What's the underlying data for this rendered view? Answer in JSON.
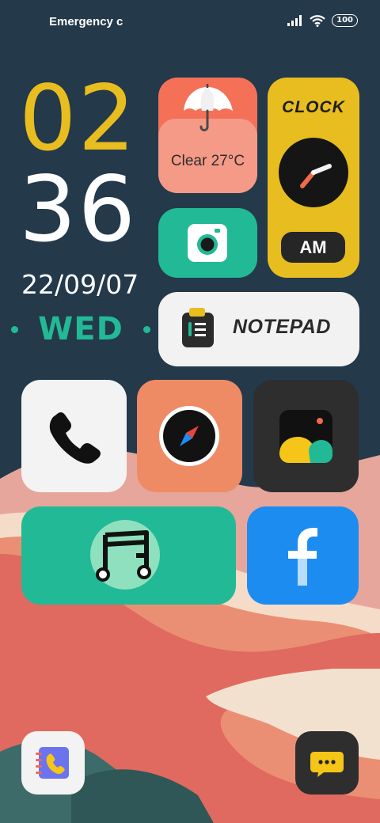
{
  "status_bar": {
    "carrier": "Emergency c",
    "battery": "100"
  },
  "clock": {
    "hour": "02",
    "minute": "36",
    "date": "22/09/07",
    "day": "WED"
  },
  "widgets": {
    "weather": {
      "text": "Clear 27°C",
      "icon": "umbrella-icon"
    },
    "camera": {
      "icon": "camera-icon"
    },
    "clock_widget": {
      "title": "CLOCK",
      "period": "AM"
    },
    "notepad": {
      "label": "NOTEPAD",
      "icon": "clipboard-icon"
    }
  },
  "apps": [
    {
      "name": "phone",
      "icon": "phone-icon"
    },
    {
      "name": "compass",
      "icon": "compass-icon"
    },
    {
      "name": "gallery",
      "icon": "gallery-icon"
    },
    {
      "name": "music",
      "icon": "music-note-icon"
    },
    {
      "name": "facebook",
      "icon": "facebook-icon"
    }
  ],
  "dock": [
    {
      "name": "contacts",
      "icon": "contacts-icon"
    },
    {
      "name": "messages",
      "icon": "message-icon"
    }
  ],
  "colors": {
    "background": "#24394a",
    "yellow": "#e8bd1f",
    "green": "#22b996",
    "coral": "#f47158",
    "facebook_blue": "#1d8cf1"
  }
}
